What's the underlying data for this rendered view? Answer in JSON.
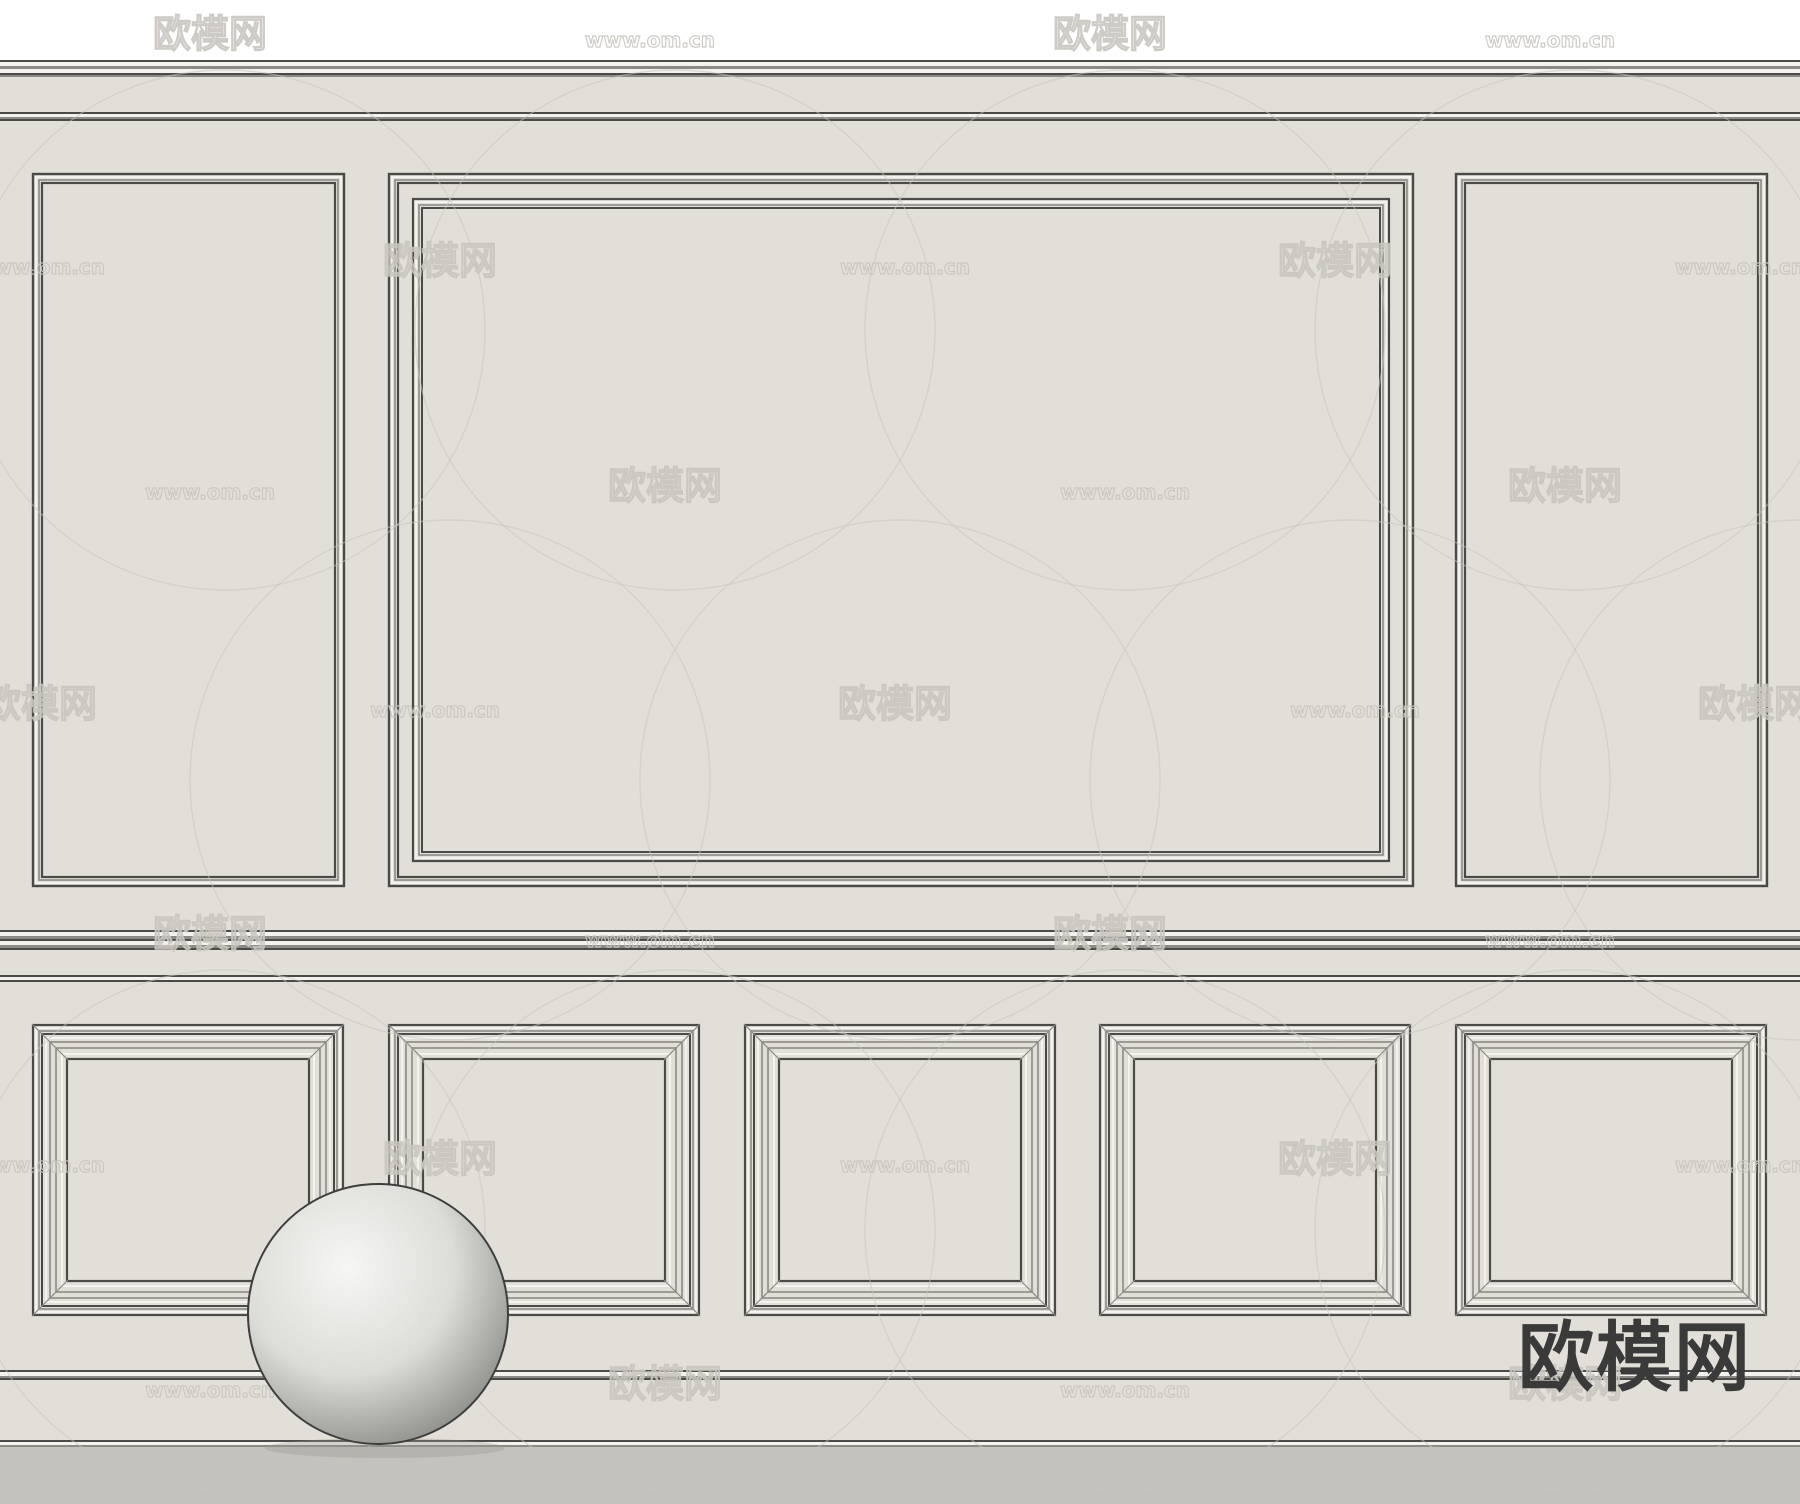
{
  "scene": {
    "subject": "wall-panel-molding-render",
    "colors": {
      "wall": "#e2dfd8",
      "molding_dark": "#4a4a48",
      "molding_mid": "#8c8a85",
      "molding_light": "#f4f2ee",
      "floor": "#c4c2bc",
      "sphere_light": "#f2f2f0",
      "sphere_shadow": "#8e8e8a",
      "watermark": "#c9c6c0",
      "logo": "#3a3a3a"
    }
  },
  "watermark": {
    "brand_text": "欧模网",
    "url_text": "www.om.cn"
  },
  "logo": {
    "text": "欧模网"
  }
}
